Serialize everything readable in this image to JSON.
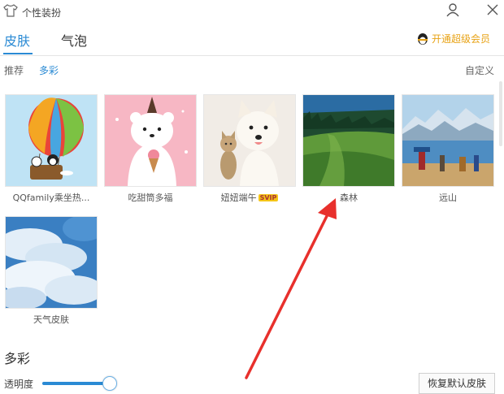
{
  "window": {
    "title": "个性装扮"
  },
  "tabs": [
    {
      "label": "皮肤"
    },
    {
      "label": "气泡"
    }
  ],
  "vip_link": "开通超级会员",
  "subtabs": [
    {
      "label": "推荐"
    },
    {
      "label": "多彩"
    }
  ],
  "custom_label": "自定义",
  "skins": [
    {
      "name": "QQfamily乘坐热...",
      "badge": ""
    },
    {
      "name": "吃甜筒多福",
      "badge": ""
    },
    {
      "name": "妞妞端午",
      "badge": "SVIP"
    },
    {
      "name": "森林",
      "badge": ""
    },
    {
      "name": "远山",
      "badge": ""
    },
    {
      "name": "天气皮肤",
      "badge": ""
    }
  ],
  "section_title": "多彩",
  "opacity": {
    "label": "透明度",
    "value_fraction": 1.0
  },
  "restore_button": "恢复默认皮肤",
  "colors": {
    "accent": "#2a8ad4",
    "vip": "#e8a316",
    "arrow": "#e8302c"
  }
}
